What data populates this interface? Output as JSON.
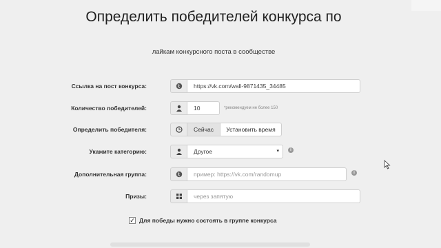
{
  "page": {
    "title": "Определить победителей конкурса по",
    "subtitle": "лайкам конкурсного поста в сообществе"
  },
  "form": {
    "post_link": {
      "label": "Ссылка на пост конкурса:",
      "icon": "globe-icon",
      "value": "https://vk.com/wall-9871435_34485"
    },
    "winners_count": {
      "label": "Количество победителей:",
      "icon": "user-icon",
      "value": "10",
      "hint": "*рекомендуем не более 150"
    },
    "determine": {
      "label": "Определить победителя:",
      "icon": "clock-icon",
      "now_label": "Сейчас",
      "set_time_label": "Установить время"
    },
    "category": {
      "label": "Укажите категорию:",
      "icon": "user-icon",
      "selected": "Другое"
    },
    "extra_group": {
      "label": "Дополнительная группа:",
      "icon": "globe-icon",
      "placeholder": "пример: https://vk.com/randomup"
    },
    "prizes": {
      "label": "Призы:",
      "icon": "gift-icon",
      "placeholder": "через запятую"
    },
    "membership": {
      "label": "Для победы нужно состоять в группе конкурса",
      "checked": true
    }
  }
}
